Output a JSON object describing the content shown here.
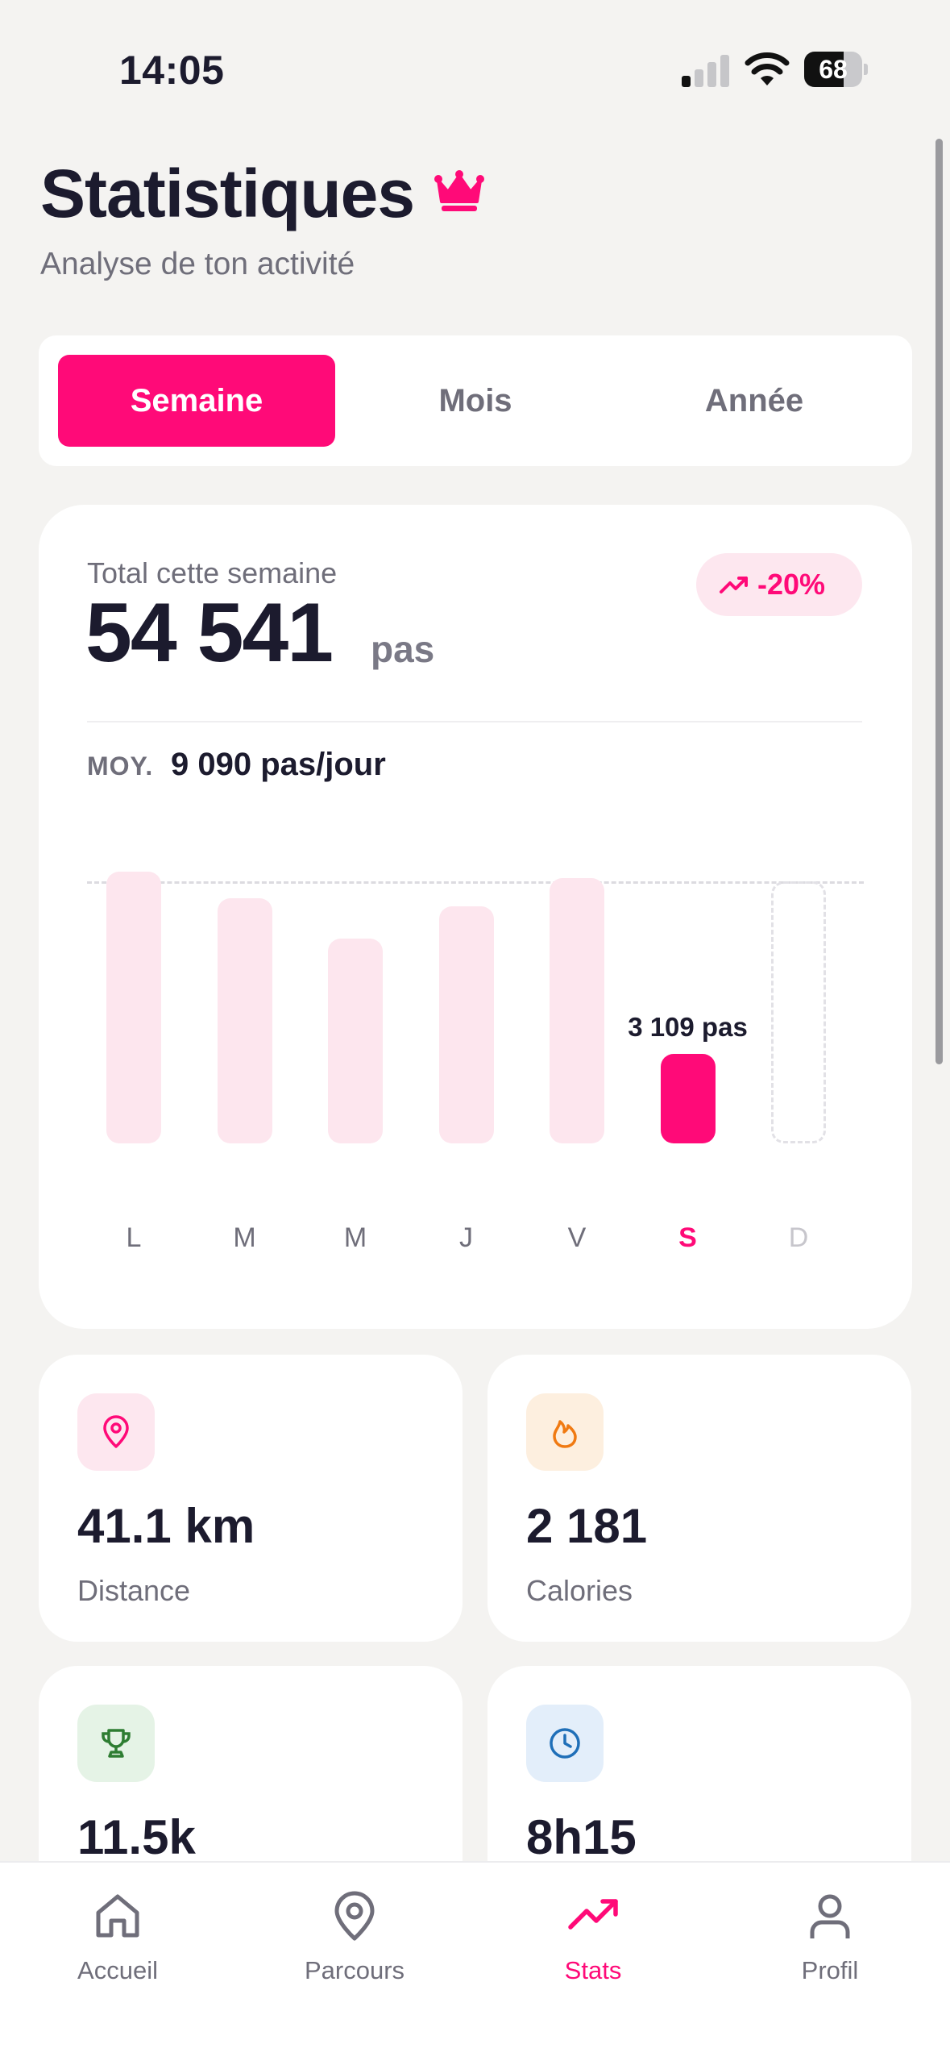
{
  "status_bar": {
    "time": "14:05",
    "battery": "68",
    "battery_level": 0.68
  },
  "header": {
    "title": "Statistiques",
    "subtitle": "Analyse de ton activité"
  },
  "period_tabs": [
    {
      "label": "Semaine",
      "active": true
    },
    {
      "label": "Mois",
      "active": false
    },
    {
      "label": "Année",
      "active": false
    }
  ],
  "summary": {
    "total_label": "Total cette semaine",
    "total_value": "54 541",
    "total_unit": "pas",
    "trend": "-20%",
    "avg_label": "MOY.",
    "avg_value": "9 090 pas/jour"
  },
  "chart_data": {
    "type": "bar",
    "categories": [
      "L",
      "M",
      "M",
      "J",
      "V",
      "S",
      "D"
    ],
    "values": [
      9400,
      8500,
      7100,
      8200,
      9200,
      3109,
      null
    ],
    "average": 9090,
    "ylim": [
      0,
      10000
    ],
    "highlight_index": 5,
    "highlight_label": "3 109 pas",
    "future_index": 6,
    "colors": {
      "past": "#fde6ee",
      "current": "#ff0a78",
      "future": "#e2e1e6"
    }
  },
  "stats": [
    {
      "value": "41.1 km",
      "label": "Distance",
      "icon": "location-pin-icon",
      "color": "#ff0a78",
      "bg": "#fde7ef"
    },
    {
      "value": "2 181",
      "label": "Calories",
      "icon": "flame-icon",
      "color": "#f07a12",
      "bg": "#fdefdf"
    },
    {
      "value": "11.5k",
      "label": "",
      "icon": "trophy-icon",
      "color": "#2e7d32",
      "bg": "#e5f3e6"
    },
    {
      "value": "8h15",
      "label": "",
      "icon": "clock-icon",
      "color": "#1f6fb8",
      "bg": "#e3eefa"
    }
  ],
  "tab_bar": [
    {
      "label": "Accueil",
      "icon": "home-icon",
      "active": false
    },
    {
      "label": "Parcours",
      "icon": "map-pin-icon",
      "active": false
    },
    {
      "label": "Stats",
      "icon": "trending-up-icon",
      "active": true
    },
    {
      "label": "Profil",
      "icon": "user-icon",
      "active": false
    }
  ],
  "accent_color": "#ff0a78"
}
